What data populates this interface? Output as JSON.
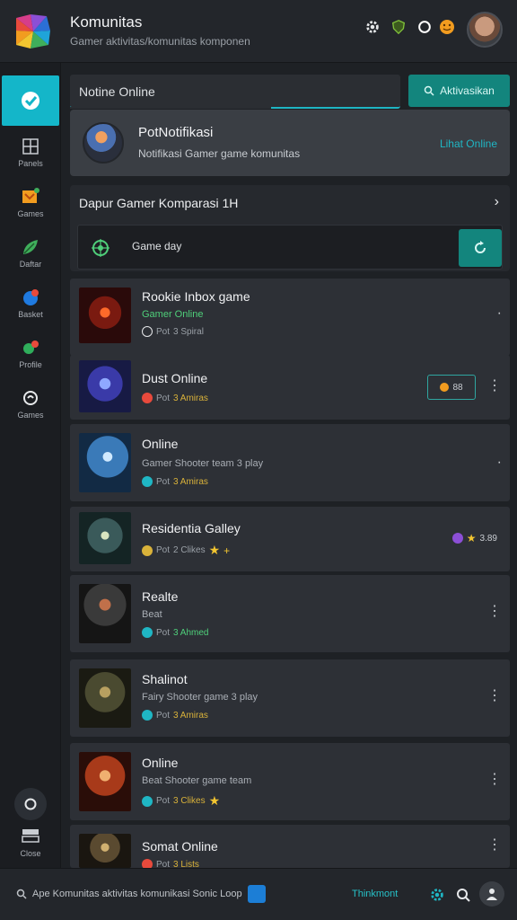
{
  "app": {
    "title": "Komunitas",
    "subtitle": "Gamer aktivitas/komunitas komponen"
  },
  "sidebar": {
    "items": [
      {
        "label": "Panels",
        "icon": "grid-icon"
      },
      {
        "label": "Games",
        "icon": "gamepad-icon"
      },
      {
        "label": "Daftar",
        "icon": "leaf-icon"
      },
      {
        "label": "Basket",
        "icon": "chat-icon"
      },
      {
        "label": "Profile",
        "icon": "people-icon"
      },
      {
        "label": "Games",
        "icon": "swirl-icon"
      }
    ],
    "bottom_label": "Close"
  },
  "search": {
    "value": "Notine Online"
  },
  "top_action": {
    "label": "Aktivasikan"
  },
  "notification": {
    "title": "PotNotifikasi",
    "subtitle": "Notifikasi Gamer game komunitas",
    "link": "Lihat Online"
  },
  "section": {
    "title": "Dapur Gamer  Komparasi  1H",
    "sub_label": "Game day"
  },
  "games": [
    {
      "title": "Rookie Inbox game",
      "sub": "Gamer Online",
      "meta_a": "Pot",
      "meta_b": "3 Spiral",
      "meta_b_color": "#9aa0a7"
    },
    {
      "title": "Dust Online",
      "sub": "",
      "meta_a": "Pot",
      "meta_b": "3 Amiras",
      "meta_b_color": "#d9b23a",
      "badge": "88"
    },
    {
      "title": "Online",
      "sub": "Gamer Shooter team 3 play",
      "meta_a": "Pot",
      "meta_b": "3 Amiras",
      "meta_b_color": "#d9b23a"
    },
    {
      "title": "Residentia Galley",
      "sub": "",
      "meta_a": "Pot",
      "meta_b": "2 Clikes",
      "meta_b_color": "#9aa0a7",
      "badge": "3.89"
    },
    {
      "title": "Realte",
      "sub": "Beat",
      "meta_a": "Pot",
      "meta_b": "3 Ahmed",
      "meta_b_color": "#4fcf7a"
    },
    {
      "title": "Shalinot",
      "sub": "Fairy Shooter game 3 play",
      "meta_a": "Pot",
      "meta_b": "3 Amiras",
      "meta_b_color": "#d9b23a"
    },
    {
      "title": "Online",
      "sub": "Beat Shooter game team",
      "meta_a": "Pot",
      "meta_b": "3 Clikes",
      "meta_b_color": "#d9b23a"
    },
    {
      "title": "Somat Online",
      "sub": "",
      "meta_a": "Pot",
      "meta_b": "3 Lists",
      "meta_b_color": "#d9b23a"
    }
  ],
  "bottombar": {
    "left_text": "Ape Komunitas aktivitas komunikasi Sonic Loop",
    "right_text": "Thinkmont"
  },
  "colors": {
    "accent": "#14b6c9",
    "teal_button": "#13857d"
  }
}
